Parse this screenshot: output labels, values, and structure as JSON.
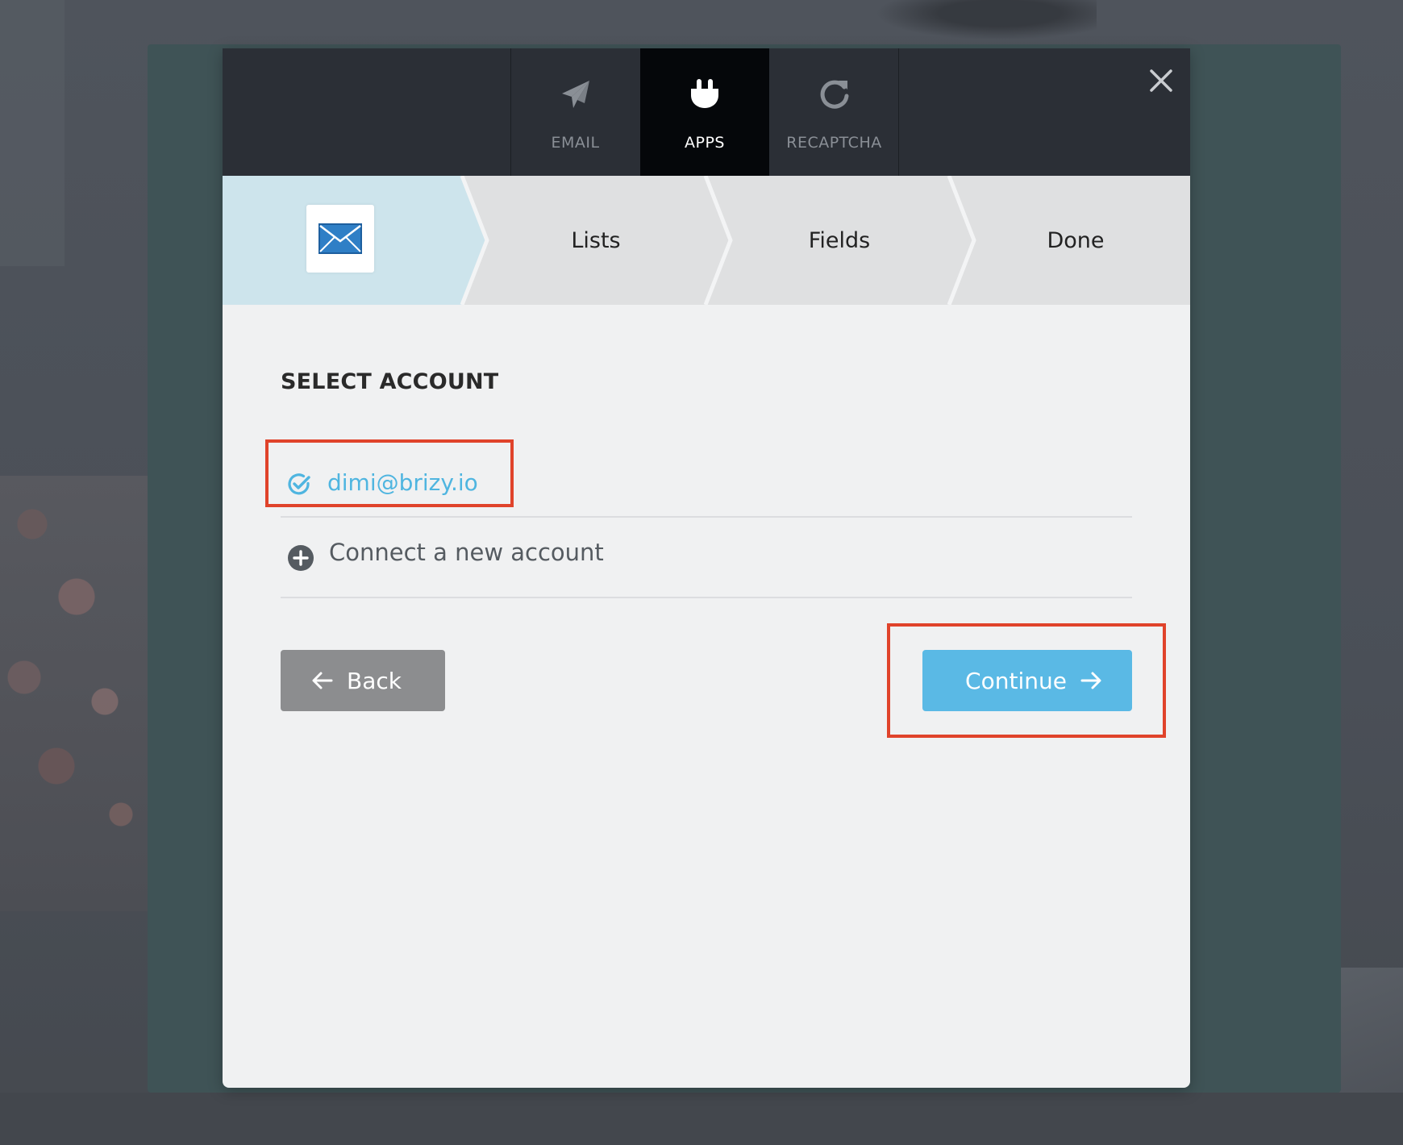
{
  "tabs": [
    {
      "label": "EMAIL",
      "icon": "paper-plane-icon",
      "active": false
    },
    {
      "label": "APPS",
      "icon": "plug-icon",
      "active": true
    },
    {
      "label": "RECAPTCHA",
      "icon": "refresh-icon",
      "active": false
    }
  ],
  "steps": [
    {
      "label": "",
      "icon": "envelope-icon",
      "active": true
    },
    {
      "label": "Lists",
      "active": false
    },
    {
      "label": "Fields",
      "active": false
    },
    {
      "label": "Done",
      "active": false
    }
  ],
  "content": {
    "section_title": "SELECT ACCOUNT",
    "account": {
      "email": "dimi@brizy.io",
      "icon": "check-circle-icon",
      "selected": true
    },
    "connect": {
      "label": "Connect a new account",
      "icon": "plus-circle-icon"
    }
  },
  "buttons": {
    "back_label": "Back",
    "continue_label": "Continue"
  },
  "colors": {
    "accent": "#5ab9e5",
    "active_step": "#cde4ec",
    "highlight": "#e0432b",
    "topbar": "#2b2f36"
  }
}
